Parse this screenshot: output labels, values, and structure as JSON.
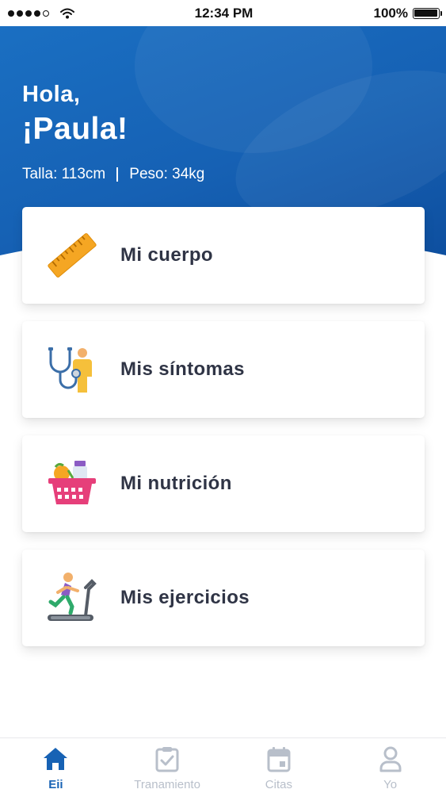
{
  "status_bar": {
    "time": "12:34 PM",
    "battery": "100%",
    "signal_icon": "signal-dots-icon",
    "wifi_icon": "wifi-icon",
    "battery_icon": "battery-icon"
  },
  "header": {
    "greeting": "Hola,",
    "name": "¡Paula!",
    "height_text": "Talla: 113cm",
    "weight_text": "Peso: 34kg",
    "colors": {
      "primary": "#1762b4",
      "primary_dark": "#0e4f9f"
    }
  },
  "cards": [
    {
      "label": "Mi cuerpo",
      "icon": "ruler-icon"
    },
    {
      "label": "Mis síntomas",
      "icon": "stethoscope-icon"
    },
    {
      "label": "Mi nutrición",
      "icon": "food-basket-icon"
    },
    {
      "label": "Mis ejercicios",
      "icon": "treadmill-icon"
    }
  ],
  "bottom_nav": {
    "items": [
      {
        "label": "Eii",
        "icon": "home-icon",
        "active": true
      },
      {
        "label": "Tranamiento",
        "icon": "clipboard-check-icon",
        "active": false
      },
      {
        "label": "Citas",
        "icon": "calendar-icon",
        "active": false
      },
      {
        "label": "Yo",
        "icon": "user-icon",
        "active": false
      }
    ],
    "colors": {
      "active": "#1762b4",
      "inactive": "#b8bfca"
    }
  }
}
